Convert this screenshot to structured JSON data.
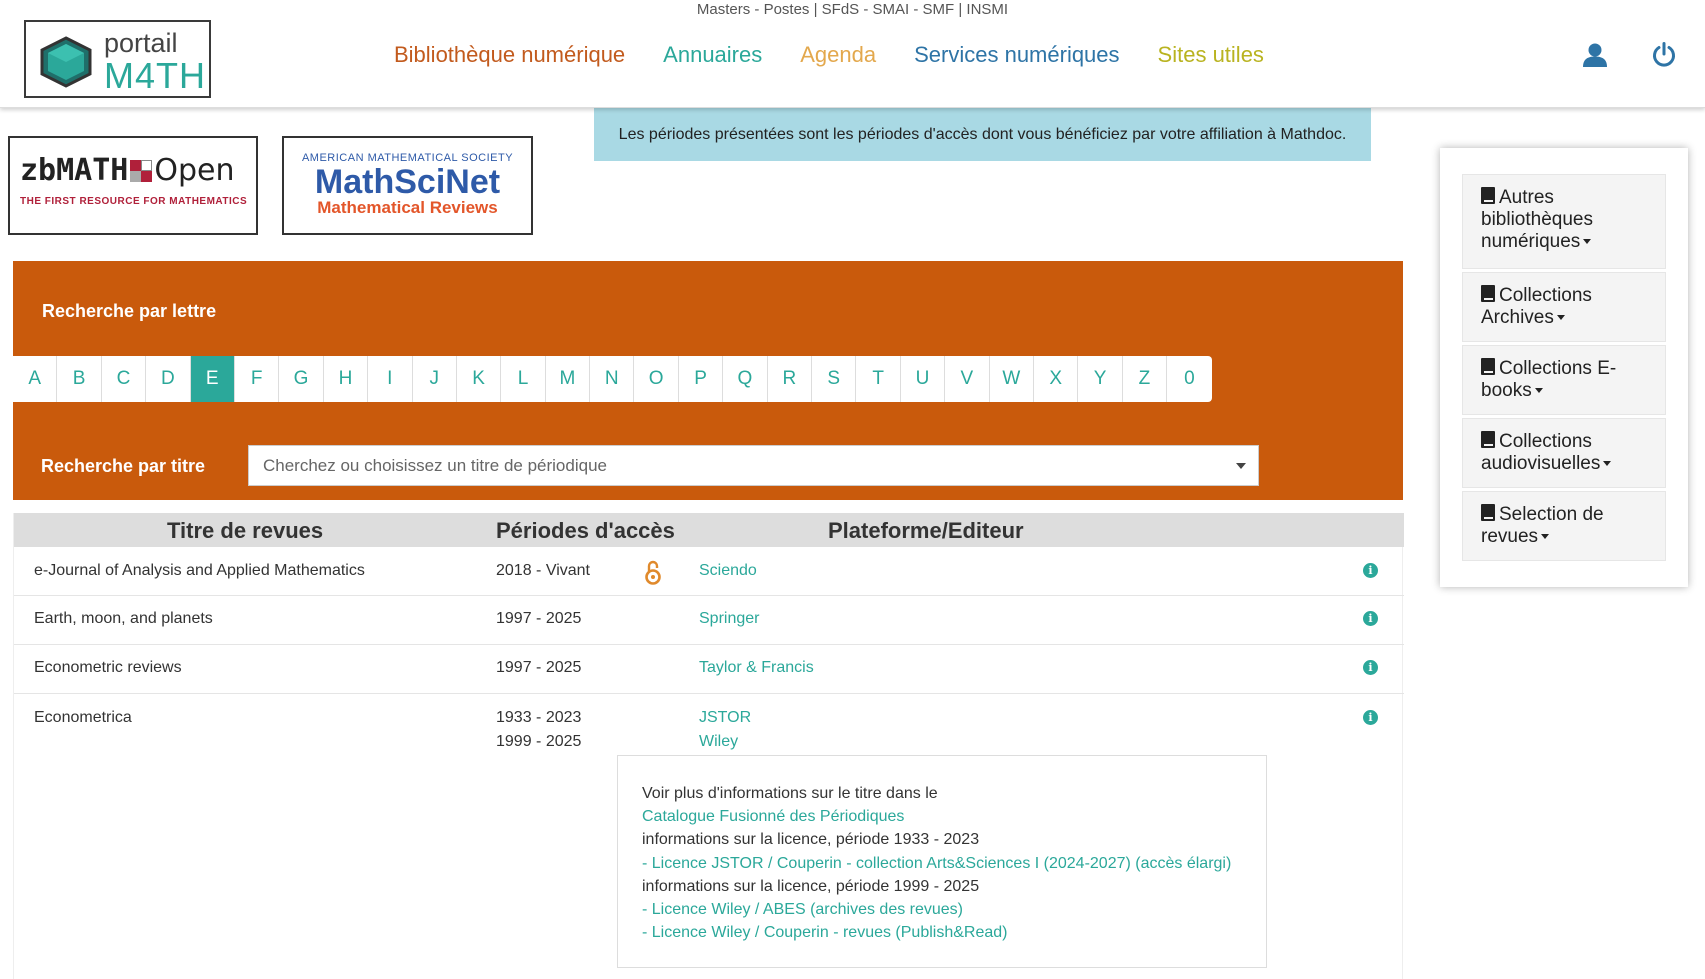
{
  "header": {
    "top_links": "Masters - Postes | SFdS - SMAI - SMF | INSMI",
    "logo": {
      "line1": "portail",
      "line2": "M4TH"
    },
    "nav": [
      {
        "label": "Bibliothèque numérique",
        "color": "#c25a1d"
      },
      {
        "label": "Annuaires",
        "color": "#2ba89a"
      },
      {
        "label": "Agenda",
        "color": "#e3a84d"
      },
      {
        "label": "Services numériques",
        "color": "#2e74a6"
      },
      {
        "label": "Sites utiles",
        "color": "#b9b320"
      }
    ],
    "icons": [
      "user-icon",
      "power-icon"
    ]
  },
  "banner": {
    "text": "Les périodes présentées sont les périodes d'accès dont vous bénéficiez par votre affiliation à Mathdoc."
  },
  "partner_logos": {
    "zbmath": {
      "name_bold": "zbMATH",
      "name_light": "Open",
      "tagline": "THE FIRST RESOURCE FOR MATHEMATICS"
    },
    "mathscinet": {
      "top": "AMERICAN MATHEMATICAL SOCIETY",
      "name": "MathSciNet",
      "sub": "Mathematical Reviews"
    }
  },
  "search": {
    "letter_label": "Recherche par lettre",
    "letters": [
      "A",
      "B",
      "C",
      "D",
      "E",
      "F",
      "G",
      "H",
      "I",
      "J",
      "K",
      "L",
      "M",
      "N",
      "O",
      "P",
      "Q",
      "R",
      "S",
      "T",
      "U",
      "V",
      "W",
      "X",
      "Y",
      "Z",
      "0"
    ],
    "active_letter": "E",
    "title_label": "Recherche par titre",
    "title_placeholder": "Cherchez ou choisissez un titre de périodique"
  },
  "table": {
    "headers": [
      "Titre de revues",
      "Périodes d'accès",
      "Plateforme/Editeur"
    ],
    "rows": [
      {
        "title": "e-Journal of Analysis and Applied Mathematics",
        "periods": [
          "2018 - Vivant"
        ],
        "open_access": true,
        "platforms": [
          "Sciendo"
        ]
      },
      {
        "title": "Earth, moon, and planets",
        "periods": [
          "1997 - 2025"
        ],
        "open_access": false,
        "platforms": [
          "Springer"
        ]
      },
      {
        "title": "Econometric reviews",
        "periods": [
          "1997 - 2025"
        ],
        "open_access": false,
        "platforms": [
          "Taylor & Francis"
        ]
      },
      {
        "title": "Econometrica",
        "periods": [
          "1933 - 2023",
          "1999 - 2025"
        ],
        "open_access": false,
        "platforms": [
          "JSTOR",
          "Wiley"
        ]
      }
    ],
    "detail": {
      "intro": "Voir plus d'informations sur le titre dans le",
      "catalog_link": "Catalogue Fusionné des Périodiques",
      "licence1_label": "informations sur la licence, période 1933 - 2023",
      "licence1_link": "- Licence JSTOR / Couperin - collection Arts&Sciences I (2024-2027) (accès élargi)",
      "licence2_label": "informations sur la licence, période 1999 - 2025",
      "licence2_link1": "- Licence Wiley / ABES (archives des revues)",
      "licence2_link2": "- Licence Wiley / Couperin - revues (Publish&Read)"
    }
  },
  "sidebar": {
    "items": [
      {
        "label": "Autres bibliothèques numériques"
      },
      {
        "label": "Collections Archives"
      },
      {
        "label": "Collections E-books"
      },
      {
        "label": "Collections audiovisuelles"
      },
      {
        "label": "Selection de revues"
      }
    ]
  }
}
